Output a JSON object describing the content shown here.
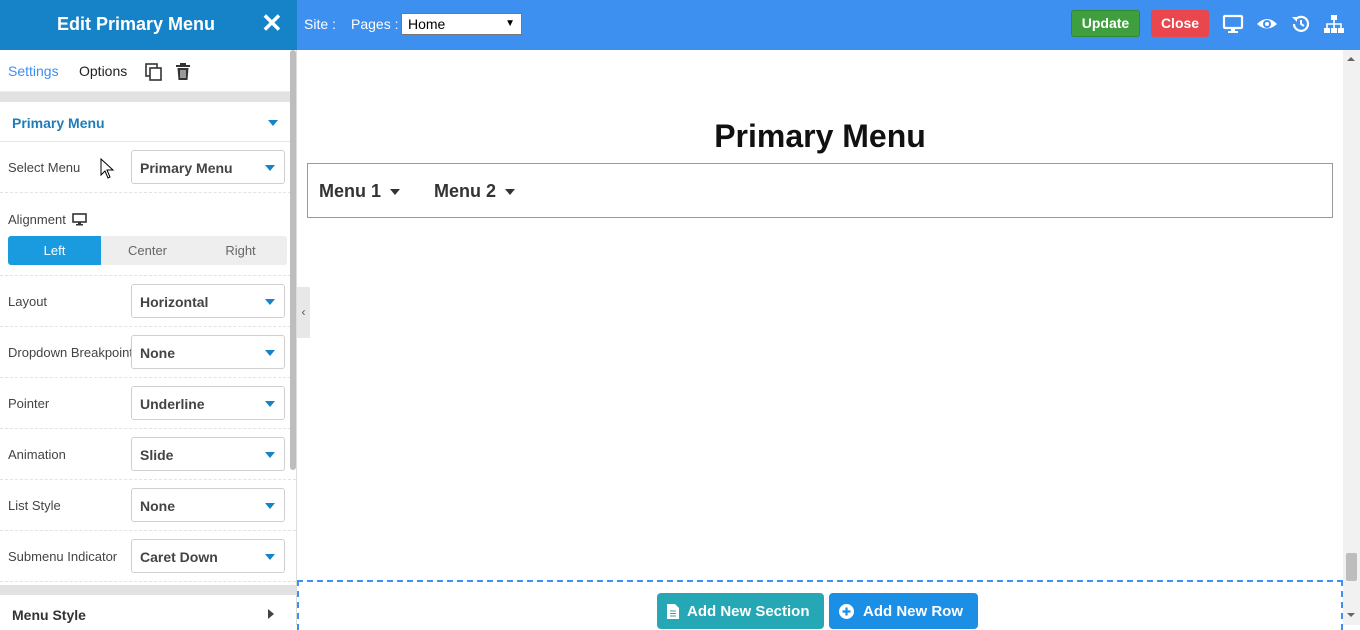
{
  "header": {
    "panel_title": "Edit Primary Menu",
    "close_glyph": "✕",
    "site_label": "Site :",
    "pages_label": "Pages :",
    "pages_value": "Home",
    "update_label": "Update",
    "close_label": "Close",
    "icons": [
      "desktop-icon",
      "eye-icon",
      "history-icon",
      "sitemap-icon"
    ]
  },
  "panel": {
    "tabs": {
      "settings": "Settings",
      "options": "Options"
    },
    "section_title": "Primary Menu",
    "fields": [
      {
        "label": "Select Menu",
        "value": "Primary Menu"
      },
      {
        "label": "Layout",
        "value": "Horizontal"
      },
      {
        "label": "Dropdown Breakpoint",
        "value": "None"
      },
      {
        "label": "Pointer",
        "value": "Underline"
      },
      {
        "label": "Animation",
        "value": "Slide"
      },
      {
        "label": "List Style",
        "value": "None"
      },
      {
        "label": "Submenu Indicator",
        "value": "Caret Down"
      }
    ],
    "alignment": {
      "label": "Alignment",
      "options": [
        "Left",
        "Center",
        "Right"
      ],
      "selected": "Left"
    },
    "bottom_section": "Menu Style",
    "collapse_glyph": "‹"
  },
  "canvas": {
    "title": "Primary Menu",
    "menu_items": [
      "Menu 1",
      "Menu 2"
    ],
    "add_section": "Add New Section",
    "add_row": "Add New Row"
  },
  "colors": {
    "topbar": "#3d8ff0",
    "panel_header": "#1683c9",
    "update": "#3f9f3f",
    "close": "#e9474d",
    "accent": "#1a9be0"
  }
}
